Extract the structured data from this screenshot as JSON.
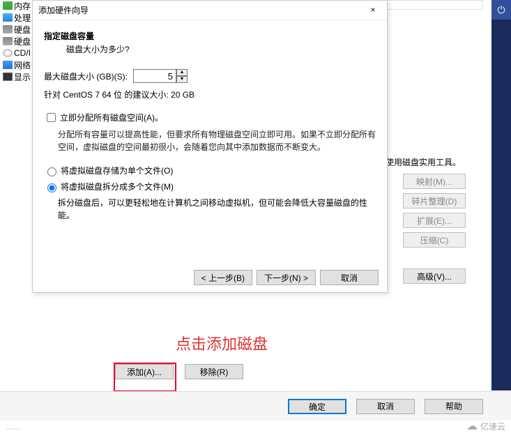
{
  "sidebar": {
    "items": [
      "内存",
      "处理",
      "硬盘",
      "硬盘",
      "CD/I",
      "网络",
      "显示"
    ]
  },
  "dialog": {
    "title": "添加硬件向导",
    "close": "×",
    "heading": "指定磁盘容量",
    "subhead": "磁盘大小为多少?",
    "max_label": "最大磁盘大小 (GB)(S):",
    "max_value": "5",
    "recommend": "针对 CentOS 7 64 位 的建议大小: 20 GB",
    "alloc_label": "立即分配所有磁盘空间(A)。",
    "alloc_help": "分配所有容量可以提高性能，但要求所有物理磁盘空间立即可用。如果不立即分配所有空间，虚拟磁盘的空间最初很小，会随着您向其中添加数据而不断变大。",
    "radio_single": "将虚拟磁盘存储为单个文件(O)",
    "radio_multi": "将虚拟磁盘拆分成多个文件(M)",
    "multi_help": "拆分磁盘后，可以更轻松地在计算机之间移动虚拟机，但可能会降低大容量磁盘的性能。",
    "back": "< 上一步(B)",
    "next": "下一步(N) >",
    "cancel": "取消"
  },
  "right": {
    "util_label": "使用磁盘实用工具。",
    "map": "映射(M)...",
    "defrag": "碎片整理(D)",
    "expand": "扩展(E)...",
    "compress": "压缩(C)",
    "advanced": "高级(V)..."
  },
  "addremove": {
    "add": "添加(A)...",
    "remove": "移除(R)"
  },
  "annotation": "点击添加磁盘",
  "bottom": {
    "ok": "确定",
    "cancel": "取消",
    "help": "帮助"
  },
  "watermark": "亿速云",
  "power_icon": "⏻"
}
